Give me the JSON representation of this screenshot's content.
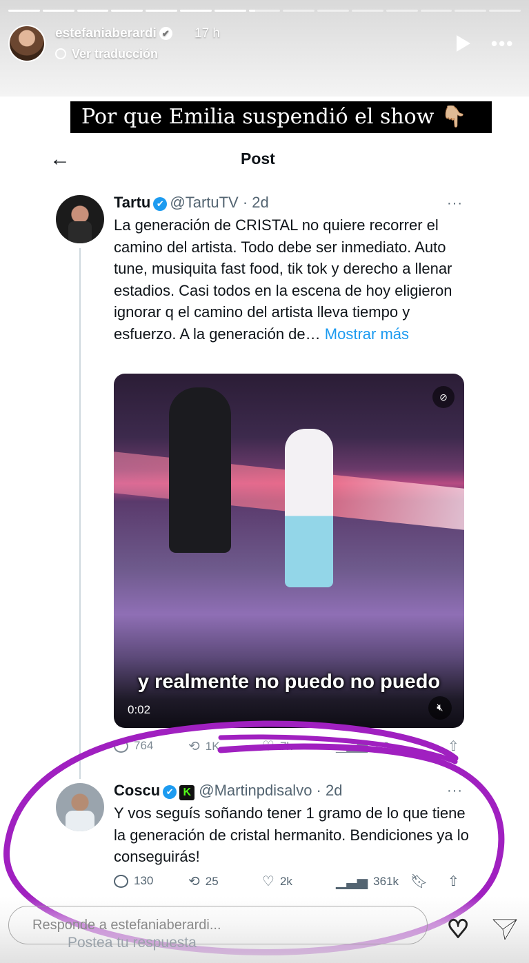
{
  "story": {
    "username": "estefaniaberardi",
    "time": "17 h",
    "translate": "Ver traducción",
    "progress_segments": 15,
    "progress_done": 7
  },
  "caption": "Por que Emilia suspendió el show 👇🏼",
  "x_post": {
    "back_label": "←",
    "title": "Post"
  },
  "tweet1": {
    "name": "Tartu",
    "handle": "@TartuTV · 2d",
    "text": "La generación de CRISTAL no quiere recorrer el camino del artista. Todo debe ser inmediato. Auto tune, musiquita fast food, tik tok y derecho a llenar estadios. Casi todos en la escena de hoy eligieron ignorar q el camino del artista lleva tiempo y esfuerzo. A la generación de…",
    "more": "Mostrar más",
    "video_subtitle": "y realmente no puedo no puedo",
    "video_duration": "0:02",
    "stats": {
      "replies": "764",
      "reposts": "1K",
      "likes": "7k",
      "views": "2,9"
    }
  },
  "tweet2": {
    "name": "Coscu",
    "badge": "K",
    "handle": "@Martinpdisalvo · 2d",
    "text": "Y vos seguís soñando tener 1 gramo de lo que tiene la generación de cristal hermanito. Bendiciones ya lo conseguirás!",
    "stats": {
      "replies": "130",
      "reposts": "25",
      "likes": "2k",
      "views": "361k"
    }
  },
  "reply": {
    "placeholder": "Responde a estefaniaberardi...",
    "ghost": "Postea tu respuesta"
  },
  "colors": {
    "accent_blue": "#1d9bf0",
    "scribble_purple": "#a020c0",
    "text_gray": "#536471"
  },
  "icons": [
    "globe-icon",
    "play-icon",
    "more-icon",
    "back-arrow-icon",
    "verified-icon",
    "reply-icon",
    "repost-icon",
    "like-icon",
    "views-icon",
    "bookmark-icon",
    "share-icon",
    "heart-icon",
    "send-icon",
    "mute-icon"
  ]
}
